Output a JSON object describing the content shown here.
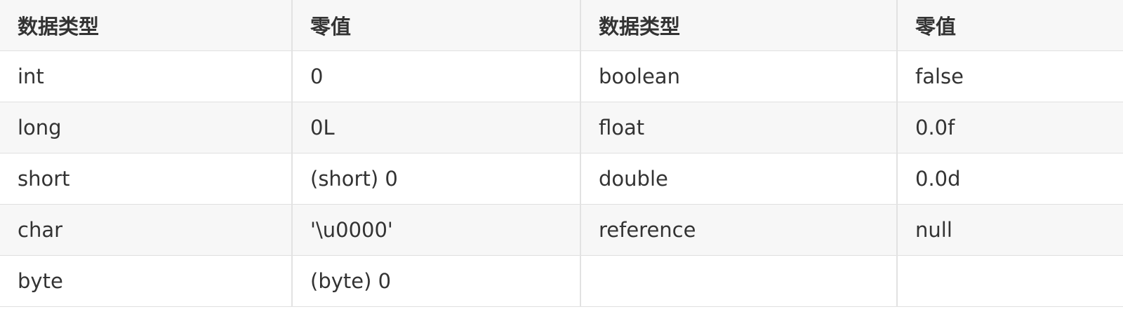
{
  "table": {
    "headers": [
      "数据类型",
      "零值",
      "数据类型",
      "零值"
    ],
    "rows": [
      [
        "int",
        "0",
        "boolean",
        "false"
      ],
      [
        "long",
        "0L",
        "float",
        "0.0f"
      ],
      [
        "short",
        "(short) 0",
        "double",
        "0.0d"
      ],
      [
        "char",
        "'\\u0000'",
        "reference",
        "null"
      ],
      [
        "byte",
        "(byte) 0",
        "",
        ""
      ]
    ]
  }
}
